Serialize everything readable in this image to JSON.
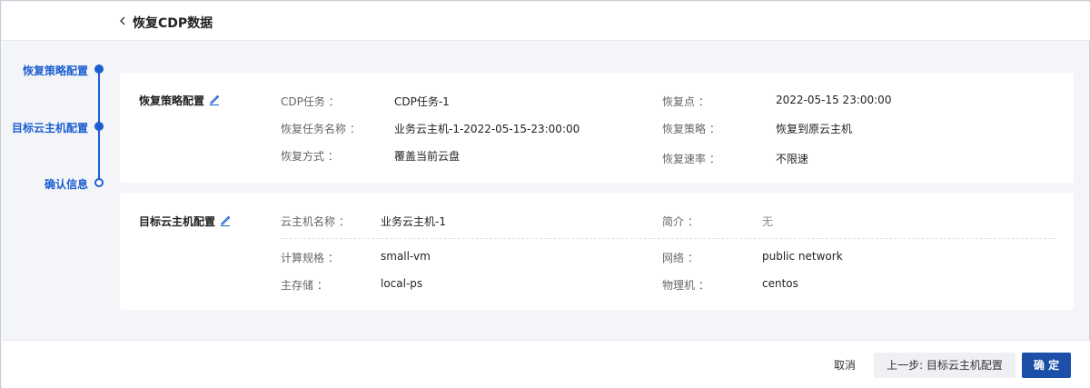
{
  "header": {
    "title": "恢复CDP数据"
  },
  "stepper": {
    "steps": [
      {
        "label": "恢复策略配置"
      },
      {
        "label": "目标云主机配置"
      },
      {
        "label": "确认信息"
      }
    ]
  },
  "cards": {
    "policy": {
      "title": "恢复策略配置",
      "fields": {
        "cdp_task_label": "CDP任务 ：",
        "cdp_task_value": "CDP任务-1",
        "restore_point_label": "恢复点 ：",
        "restore_point_value": "2022-05-15 23:00:00",
        "task_name_label": "恢复任务名称 ：",
        "task_name_value": "业务云主机-1-2022-05-15-23:00:00",
        "strategy_label": "恢复策略 ：",
        "strategy_value": "恢复到原云主机",
        "mode_label": "恢复方式 ：",
        "mode_value": "覆盖当前云盘",
        "rate_label": "恢复速率 ：",
        "rate_value": "不限速"
      }
    },
    "target": {
      "title": "目标云主机配置",
      "fields": {
        "vm_name_label": "云主机名称 ：",
        "vm_name_value": "业务云主机-1",
        "desc_label": "简介 ：",
        "desc_value": "无",
        "spec_label": "计算规格 ：",
        "spec_value": "small-vm",
        "network_label": "网络 ：",
        "network_value": "public network",
        "storage_label": "主存储 ：",
        "storage_value": "local-ps",
        "host_label": "物理机 ：",
        "host_value": "centos"
      }
    }
  },
  "footer": {
    "cancel": "取消",
    "prev": "上一步: 目标云主机配置",
    "ok": "确 定"
  },
  "colors": {
    "accent": "#1c5fd1",
    "primary_button": "#1c4fa8"
  },
  "icons": [
    "chevron-left-icon",
    "edit-pencil-icon"
  ]
}
